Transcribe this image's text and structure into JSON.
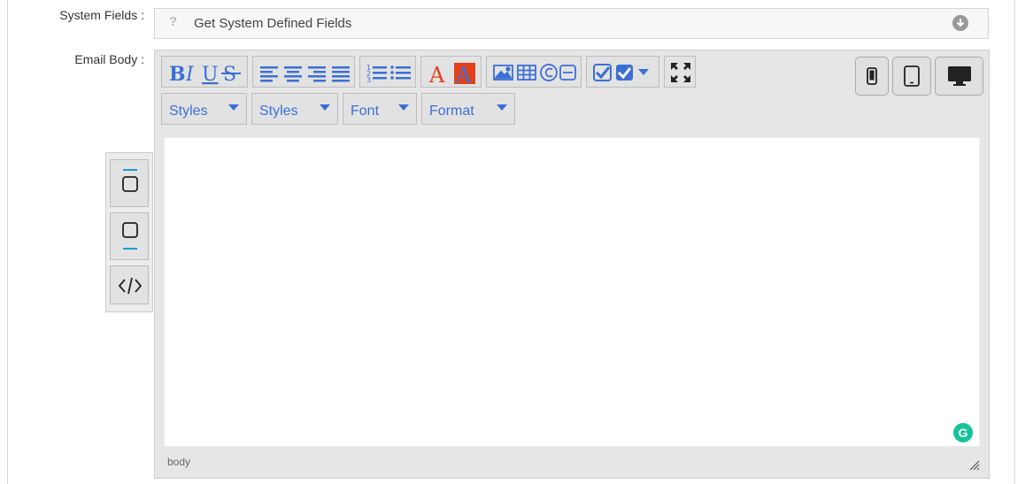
{
  "system_fields": {
    "label": "System Fields :",
    "help_glyph": "?",
    "value": "Get System Defined Fields",
    "dropdown_icon": "circle-arrow-down-icon"
  },
  "email_body": {
    "label": "Email Body :"
  },
  "toolbar": {
    "format_group_text": "BIUS",
    "dropdowns": [
      {
        "label": "Styles"
      },
      {
        "label": "Styles"
      },
      {
        "label": "Font"
      },
      {
        "label": "Format"
      }
    ],
    "device_buttons": [
      "mobile-icon",
      "tablet-icon",
      "desktop-icon"
    ]
  },
  "editor": {
    "status_path": "body",
    "grammarly_letter": "G"
  },
  "side_panel": {
    "buttons": [
      "block-top-icon",
      "block-bottom-icon",
      "source-code-icon"
    ]
  },
  "colors": {
    "accent": "#3b6fd6",
    "text_color_icon": "#e2411a",
    "grammarly": "#15c39a",
    "toolbar_bg": "#e2e2e2"
  }
}
